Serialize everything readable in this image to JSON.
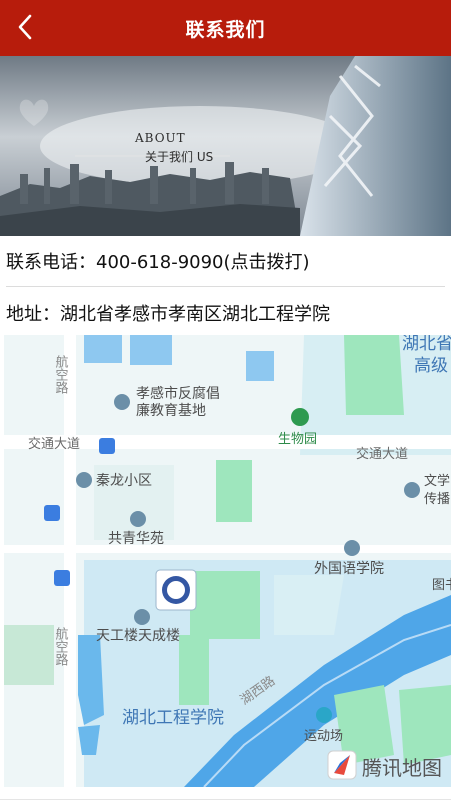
{
  "header": {
    "title": "联系我们",
    "back_icon": "chevron-left-icon"
  },
  "banner": {
    "about": "ABOUT",
    "subtitle": "关于我们 US"
  },
  "contact": {
    "phone_text": "联系电话：400-618-9090(点击拨打)",
    "address_text": "地址：湖北省孝感市孝南区湖北工程学院"
  },
  "map": {
    "labels": {
      "hangkong_road_top": "航空路",
      "hangkong_road_bottom": "航空路",
      "anticorruption_line1": "孝感市反腐倡",
      "anticorruption_line2": "廉教育基地",
      "biology_park": "生物园",
      "jiaotong_left": "交通大道",
      "jiaotong_right": "交通大道",
      "qinlong": "秦龙小区",
      "gongqing": "共青华苑",
      "foreign_lang": "外国语学院",
      "tiangong": "天工楼天成楼",
      "hubei_engineering": "湖北工程学院",
      "hubei_west_road": "湖西路",
      "playground": "运动场",
      "hubei_top_line1": "湖北省",
      "hubei_top_line2": "高级",
      "wenxue_line1": "文学",
      "wenxue_line2": "传播",
      "library_partial": "图书",
      "watermark": "腾讯地图"
    },
    "colors": {
      "water": "#bfe2f2",
      "green": "#9ee6bd",
      "land": "#eef6f7",
      "road": "#ffffff"
    }
  }
}
